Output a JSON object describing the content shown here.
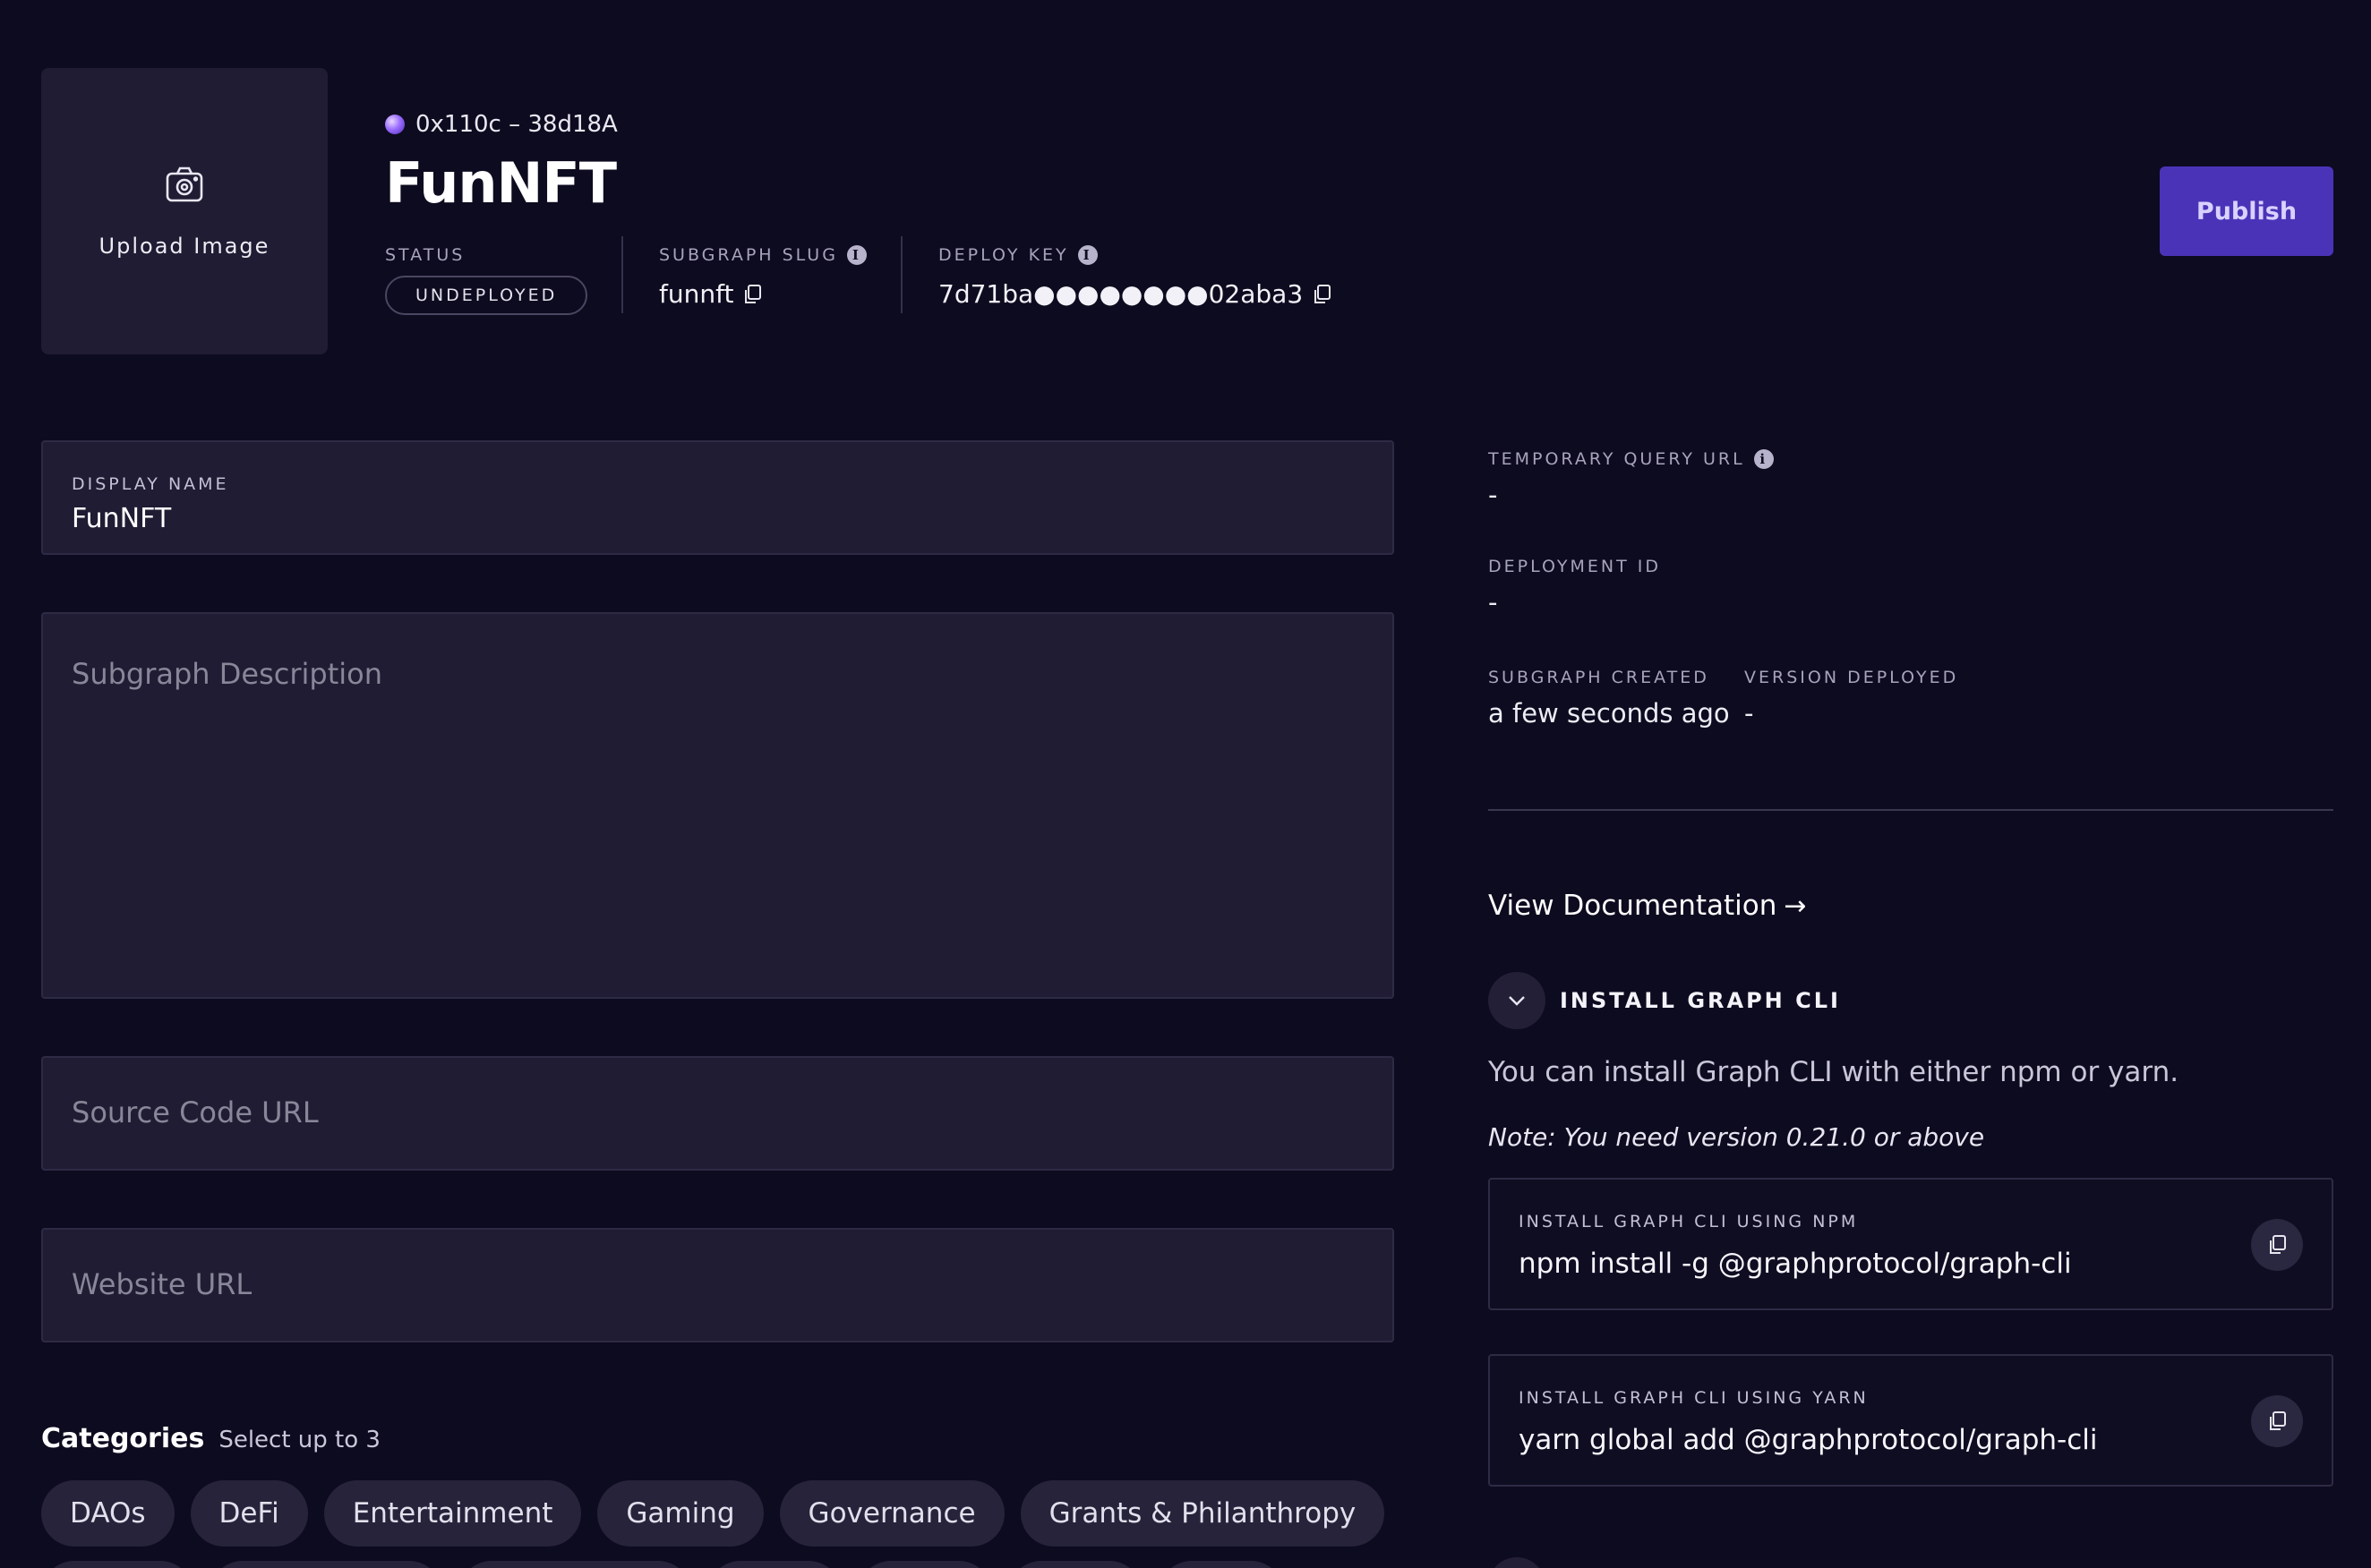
{
  "header": {
    "upload_label": "Upload Image",
    "owner": "0x110c – 38d18A",
    "title": "FunNFT",
    "status_label": "STATUS",
    "status_value": "UNDEPLOYED",
    "slug_label": "SUBGRAPH SLUG",
    "slug_value": "funnft",
    "deploy_key_label": "DEPLOY KEY",
    "deploy_key_value": "7d71ba●●●●●●●●02aba3",
    "publish_label": "Publish"
  },
  "form": {
    "display_name_label": "DISPLAY NAME",
    "display_name_value": "FunNFT",
    "description_placeholder": "Subgraph Description",
    "source_placeholder": "Source Code URL",
    "website_placeholder": "Website URL",
    "categories_title": "Categories",
    "categories_hint": "Select up to 3",
    "categories": [
      "DAOs",
      "DeFi",
      "Entertainment",
      "Gaming",
      "Governance",
      "Grants & Philanthropy"
    ]
  },
  "side": {
    "temp_query_label": "TEMPORARY QUERY URL",
    "temp_query_value": "-",
    "deployment_id_label": "DEPLOYMENT ID",
    "deployment_id_value": "-",
    "created_label": "SUBGRAPH CREATED",
    "created_value": "a few seconds ago",
    "version_label": "VERSION DEPLOYED",
    "version_value": "-",
    "doc_link": "View Documentation",
    "doc_arrow": "→",
    "cli_title": "INSTALL GRAPH CLI",
    "cli_text": "You can install Graph CLI with either npm or yarn.",
    "cli_note": "Note: You need version 0.21.0 or above",
    "npm_label": "INSTALL GRAPH CLI USING NPM",
    "npm_cmd": "npm install -g @graphprotocol/graph-cli",
    "yarn_label": "INSTALL GRAPH CLI USING YARN",
    "yarn_cmd": "yarn global add @graphprotocol/graph-cli"
  },
  "colors": {
    "background": "#0d0b1f",
    "panel": "#1f1c33",
    "accent": "#4b33b8"
  }
}
